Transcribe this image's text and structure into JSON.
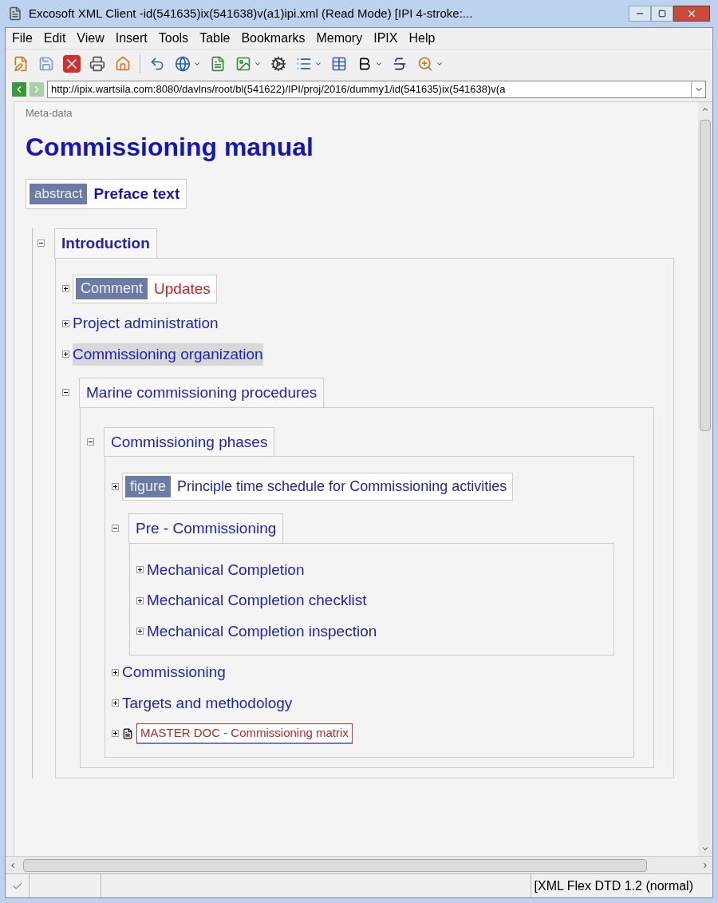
{
  "window": {
    "title": "Excosoft XML Client -id(541635)ix(541638)v(a1)ipi.xml (Read Mode) [IPI 4-stroke:..."
  },
  "menu": [
    "File",
    "Edit",
    "View",
    "Insert",
    "Tools",
    "Table",
    "Bookmarks",
    "Memory",
    "IPIX",
    "Help"
  ],
  "address": {
    "value": "http://ipix.wartsila.com:8080/davlns/root/bl(541622)/IPI/proj/2016/dummy1/id(541635)ix(541638)v(a"
  },
  "document": {
    "meta_label": "Meta-data",
    "title": "Commissioning manual",
    "abstract": {
      "tag": "abstract",
      "text": "Preface text"
    },
    "tree": [
      {
        "kind": "section",
        "title": "Introduction",
        "expanded": true,
        "selected": false,
        "children": [
          {
            "kind": "tagged",
            "tag": "Comment",
            "title": "Updates",
            "expanded": false,
            "selected": false
          },
          {
            "kind": "item",
            "title": "Project administration",
            "expanded": false,
            "selected": false
          },
          {
            "kind": "item",
            "title": "Commissioning organization",
            "expanded": false,
            "selected": true
          },
          {
            "kind": "section",
            "title": "Marine commissioning procedures",
            "expanded": true,
            "selected": false,
            "children": [
              {
                "kind": "section",
                "title": "Commissioning phases",
                "expanded": true,
                "selected": false,
                "children": [
                  {
                    "kind": "tagged",
                    "tag": "figure",
                    "title": "Principle time schedule for Commissioning activities",
                    "expanded": false,
                    "selected": false
                  },
                  {
                    "kind": "section",
                    "title": "Pre - Commissioning",
                    "expanded": true,
                    "selected": false,
                    "children": [
                      {
                        "kind": "item",
                        "title": "Mechanical Completion",
                        "expanded": false,
                        "selected": false
                      },
                      {
                        "kind": "item",
                        "title": "Mechanical Completion checklist",
                        "expanded": false,
                        "selected": false
                      },
                      {
                        "kind": "item",
                        "title": "Mechanical Completion inspection",
                        "expanded": false,
                        "selected": false
                      }
                    ]
                  },
                  {
                    "kind": "item",
                    "title": "Commissioning",
                    "expanded": false,
                    "selected": false
                  },
                  {
                    "kind": "item",
                    "title": "Targets and methodology",
                    "expanded": false,
                    "selected": false
                  },
                  {
                    "kind": "doc",
                    "title": "MASTER DOC - Commissioning matrix",
                    "expanded": false,
                    "selected": false
                  }
                ]
              }
            ]
          }
        ]
      }
    ]
  },
  "status_bar": {
    "mode": "[XML Flex DTD 1.2 (normal)"
  }
}
